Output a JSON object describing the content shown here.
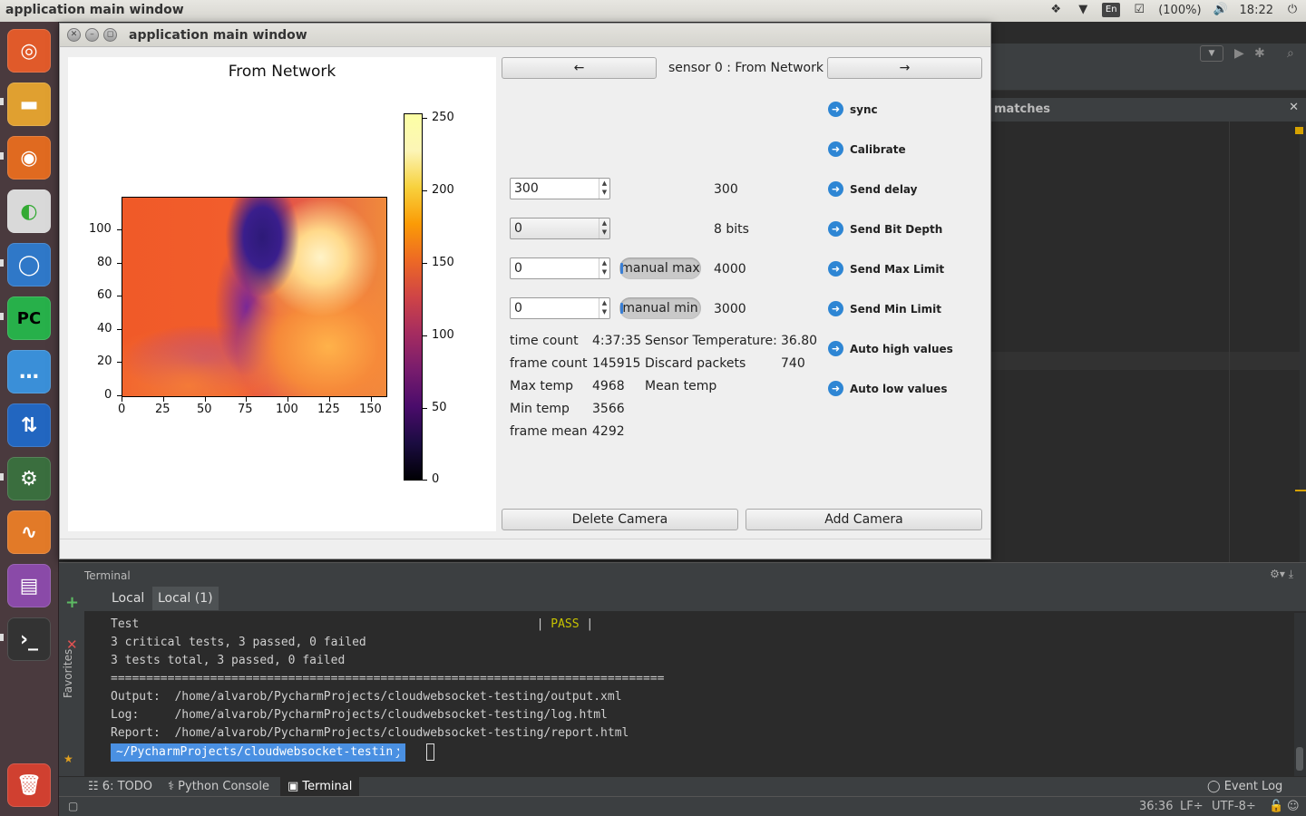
{
  "system": {
    "title": "application main window",
    "battery": "(100%)",
    "clock": "18:22",
    "lang": "En"
  },
  "window": {
    "title": "application main window"
  },
  "plot": {
    "title": "From Network",
    "x_ticks": [
      "0",
      "25",
      "50",
      "75",
      "100",
      "125",
      "150"
    ],
    "y_ticks": [
      "100",
      "80",
      "60",
      "40",
      "20",
      "0"
    ],
    "colorbar_ticks": [
      "250",
      "200",
      "150",
      "100",
      "50",
      "0"
    ]
  },
  "controls": {
    "prev_label": "←",
    "next_label": "→",
    "sensor_label": "sensor 0 : From Network",
    "delay_value": "300",
    "delay_display": "300",
    "bit_depth_value": "0",
    "bit_depth_display": "8 bits",
    "max_value": "0",
    "max_toggle": "manual max",
    "max_display": "4000",
    "min_value": "0",
    "min_toggle": "manual min",
    "min_display": "3000",
    "delete_label": "Delete Camera",
    "add_label": "Add Camera"
  },
  "commands": [
    "sync",
    "Calibrate",
    "Send delay",
    "Send Bit Depth",
    "Send Max Limit",
    "Send Min Limit",
    "Auto high values",
    "Auto low values"
  ],
  "stats": {
    "time_count_label": "time count",
    "time_count": "4:37:35",
    "sensor_temp_label": "Sensor Temperature:",
    "sensor_temp": "36.80",
    "frame_count_label": "frame count",
    "frame_count": "145915",
    "discard_label": "Discard packets",
    "discard": "740",
    "max_temp_label": "Max temp",
    "max_temp": "4968",
    "mean_temp_label": "Mean temp",
    "min_temp_label": "Min temp",
    "min_temp": "3566",
    "frame_mean_label": "frame mean",
    "frame_mean": "4292"
  },
  "ide": {
    "matches": "matches",
    "terminal_title": "Terminal",
    "tabs": [
      "Local",
      "Local (1)"
    ],
    "favorites": "Favorites",
    "tools": [
      "6: TODO",
      "Python Console",
      "Terminal"
    ],
    "event_log": "Event Log",
    "status": {
      "position": "36:36",
      "line_sep": "LF÷",
      "encoding": "UTF-8÷"
    }
  },
  "terminal": {
    "lines": [
      "Test                                                        | PASS |",
      "3 critical tests, 3 passed, 0 failed",
      "3 tests total, 3 passed, 0 failed",
      "==============================================================================",
      "Output:  /home/alvarob/PycharmProjects/cloudwebsocket-testing/output.xml",
      "Log:     /home/alvarob/PycharmProjects/cloudwebsocket-testing/log.html",
      "Report:  /home/alvarob/PycharmProjects/cloudwebsocket-testing/report.html"
    ],
    "prompt": "~/PycharmProjects/cloudwebsocket-testing"
  }
}
